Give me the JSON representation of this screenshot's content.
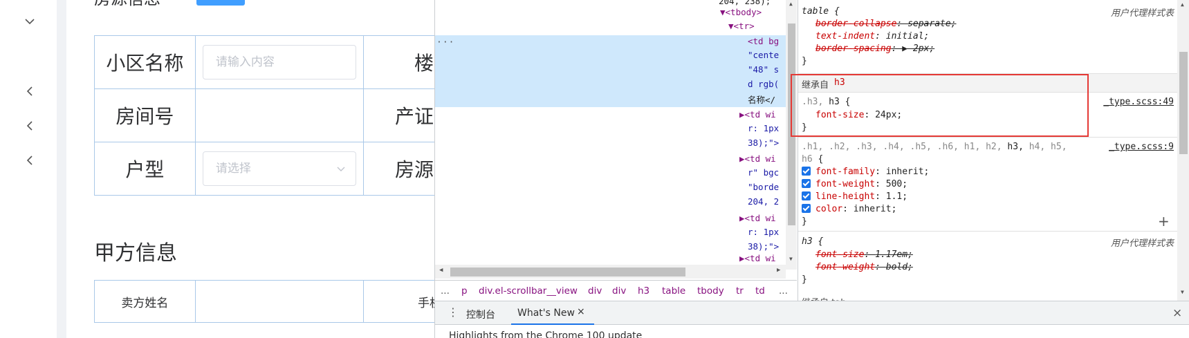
{
  "nav": {
    "icons": [
      "chevron-down-icon",
      "chevron-left-icon",
      "chevron-left-icon",
      "chevron-left-icon"
    ]
  },
  "page": {
    "title_partial": "房源信息",
    "form_rows": [
      {
        "label": "小区名称",
        "placeholder": "请输入内容",
        "right_label": "楼宇"
      },
      {
        "label": "房间号",
        "placeholder": "",
        "right_label": "产证编"
      },
      {
        "label": "户型",
        "placeholder": "请选择",
        "right_label": "房源地"
      }
    ],
    "section_title": "甲方信息",
    "section_rows": [
      {
        "label": "卖方姓名",
        "right_label": "手机号"
      }
    ]
  },
  "elements": {
    "lines": [
      {
        "indent": "",
        "text": "204, 238);"
      },
      {
        "indent": "",
        "text": "▼<tbody>"
      },
      {
        "indent": "",
        "text": "▼<tr>"
      },
      {
        "indent": "",
        "text": "<td bg"
      },
      {
        "indent": "",
        "text": "\"cente"
      },
      {
        "indent": "",
        "text": "\"48\" s"
      },
      {
        "indent": "",
        "text": "d rgb("
      },
      {
        "indent": "",
        "text": "名称</"
      },
      {
        "indent": "",
        "text": "▶<td wi"
      },
      {
        "indent": "",
        "text": "r: 1px"
      },
      {
        "indent": "",
        "text": "38);\">"
      },
      {
        "indent": "",
        "text": "▶<td wi"
      },
      {
        "indent": "",
        "text": "r\" bgc"
      },
      {
        "indent": "",
        "text": "\"borde"
      },
      {
        "indent": "",
        "text": "204, 2"
      },
      {
        "indent": "",
        "text": "▶<td wi"
      },
      {
        "indent": "",
        "text": "r: 1px"
      },
      {
        "indent": "",
        "text": "38);\">"
      },
      {
        "indent": "",
        "text": "▶<td wi"
      }
    ],
    "dots": "···",
    "breadcrumbs": [
      "...",
      "p",
      "div.el-scrollbar__view",
      "div",
      "div",
      "h3",
      "table",
      "tbody",
      "tr",
      "td",
      "..."
    ]
  },
  "styles": {
    "rule1": {
      "selector": "table {",
      "source": "用户代理样式表",
      "props": [
        {
          "name": "border-collapse",
          "value": "separate;",
          "struck": true
        },
        {
          "name": "text-indent",
          "value": "initial;",
          "struck": false
        },
        {
          "name": "border-spacing",
          "value": "▶ 2px;",
          "struck": true
        }
      ],
      "close": "}"
    },
    "inherited": {
      "label": "继承自",
      "tag": "h3"
    },
    "rule2": {
      "selector_dim": ".h3,",
      "selector": " h3 {",
      "source": "_type.scss:49",
      "props": [
        {
          "name": "font-size",
          "value": "24px;"
        }
      ],
      "close": "}"
    },
    "rule3": {
      "selector_line1_dim": ".h1, .h2, .h3, .h4, .h5, .h6, h1, h2,",
      "selector_line1_bold": " h3,",
      "selector_line1_dim2": " h4, h5,",
      "selector_line2_dim": "h6",
      "selector_line2": " {",
      "source": "_type.scss:9",
      "props": [
        {
          "name": "font-family",
          "value": "inherit;"
        },
        {
          "name": "font-weight",
          "value": "500;"
        },
        {
          "name": "line-height",
          "value": "1.1;"
        },
        {
          "name": "color",
          "value": "inherit;"
        }
      ],
      "close": "}"
    },
    "rule4": {
      "selector": "h3 {",
      "source": "用户代理样式表",
      "props": [
        {
          "name": "font-size",
          "value": "1.17em;"
        },
        {
          "name": "font-weight",
          "value": "bold;"
        }
      ],
      "close": "}"
    },
    "plus": "+",
    "cut_text": "继承自 tab"
  },
  "drawer": {
    "kebab": "⋮",
    "tabs": [
      {
        "label": "控制台",
        "active": false
      },
      {
        "label": "What's New",
        "active": true
      }
    ],
    "tab_close": "×",
    "close": "×",
    "content": "Highlights from the Chrome 100 update"
  },
  "colors": {
    "accent": "#1a73e8",
    "highlight_box": "#e53935",
    "selection_row": "#cfe8fc",
    "table_border": "#a9c8e8",
    "css_property": "#c80000",
    "html_tag": "#881280"
  }
}
